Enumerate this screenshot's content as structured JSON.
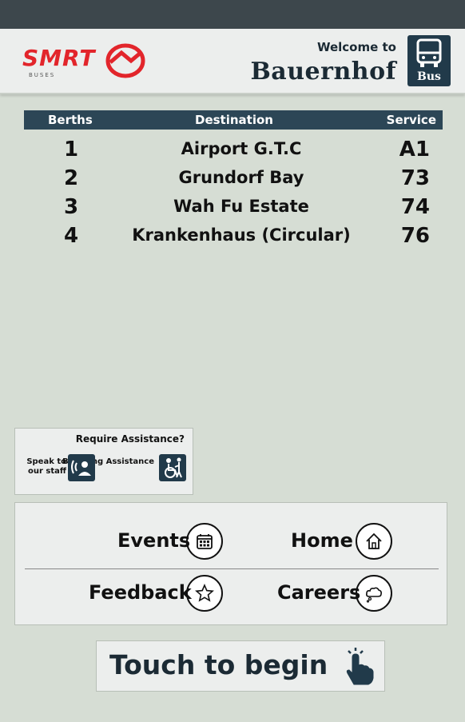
{
  "header": {
    "welcome": "Welcome to",
    "station": "Bauernhof",
    "bus_icon_label": "Bus",
    "logo_text": "SMRT",
    "logo_subtext": "BUSES"
  },
  "table": {
    "headers": {
      "service": "Service",
      "destination": "Destination",
      "berths": "Berths"
    },
    "rows": [
      {
        "service": "A1",
        "destination": "Airport G.T.C",
        "berth": "1"
      },
      {
        "service": "73",
        "destination": "Grundorf Bay",
        "berth": "2"
      },
      {
        "service": "74",
        "destination": "Wah Fu Estate",
        "berth": "3"
      },
      {
        "service": "76",
        "destination": "Krankenhaus (Circular)",
        "berth": "4"
      }
    ]
  },
  "assistance": {
    "title": "Require Assistance?",
    "boarding": "Boarding Assistance",
    "speak": "Speak to our staff"
  },
  "menu": {
    "home": "Home",
    "events": "Events",
    "careers": "Careers",
    "feedback": "Feedback"
  },
  "touch": {
    "label": "Touch to begin"
  },
  "colors": {
    "dark_blue": "#213a4a",
    "table_header": "#2c4656",
    "logo_red": "#e2252b",
    "background": "#d6ddd4"
  }
}
